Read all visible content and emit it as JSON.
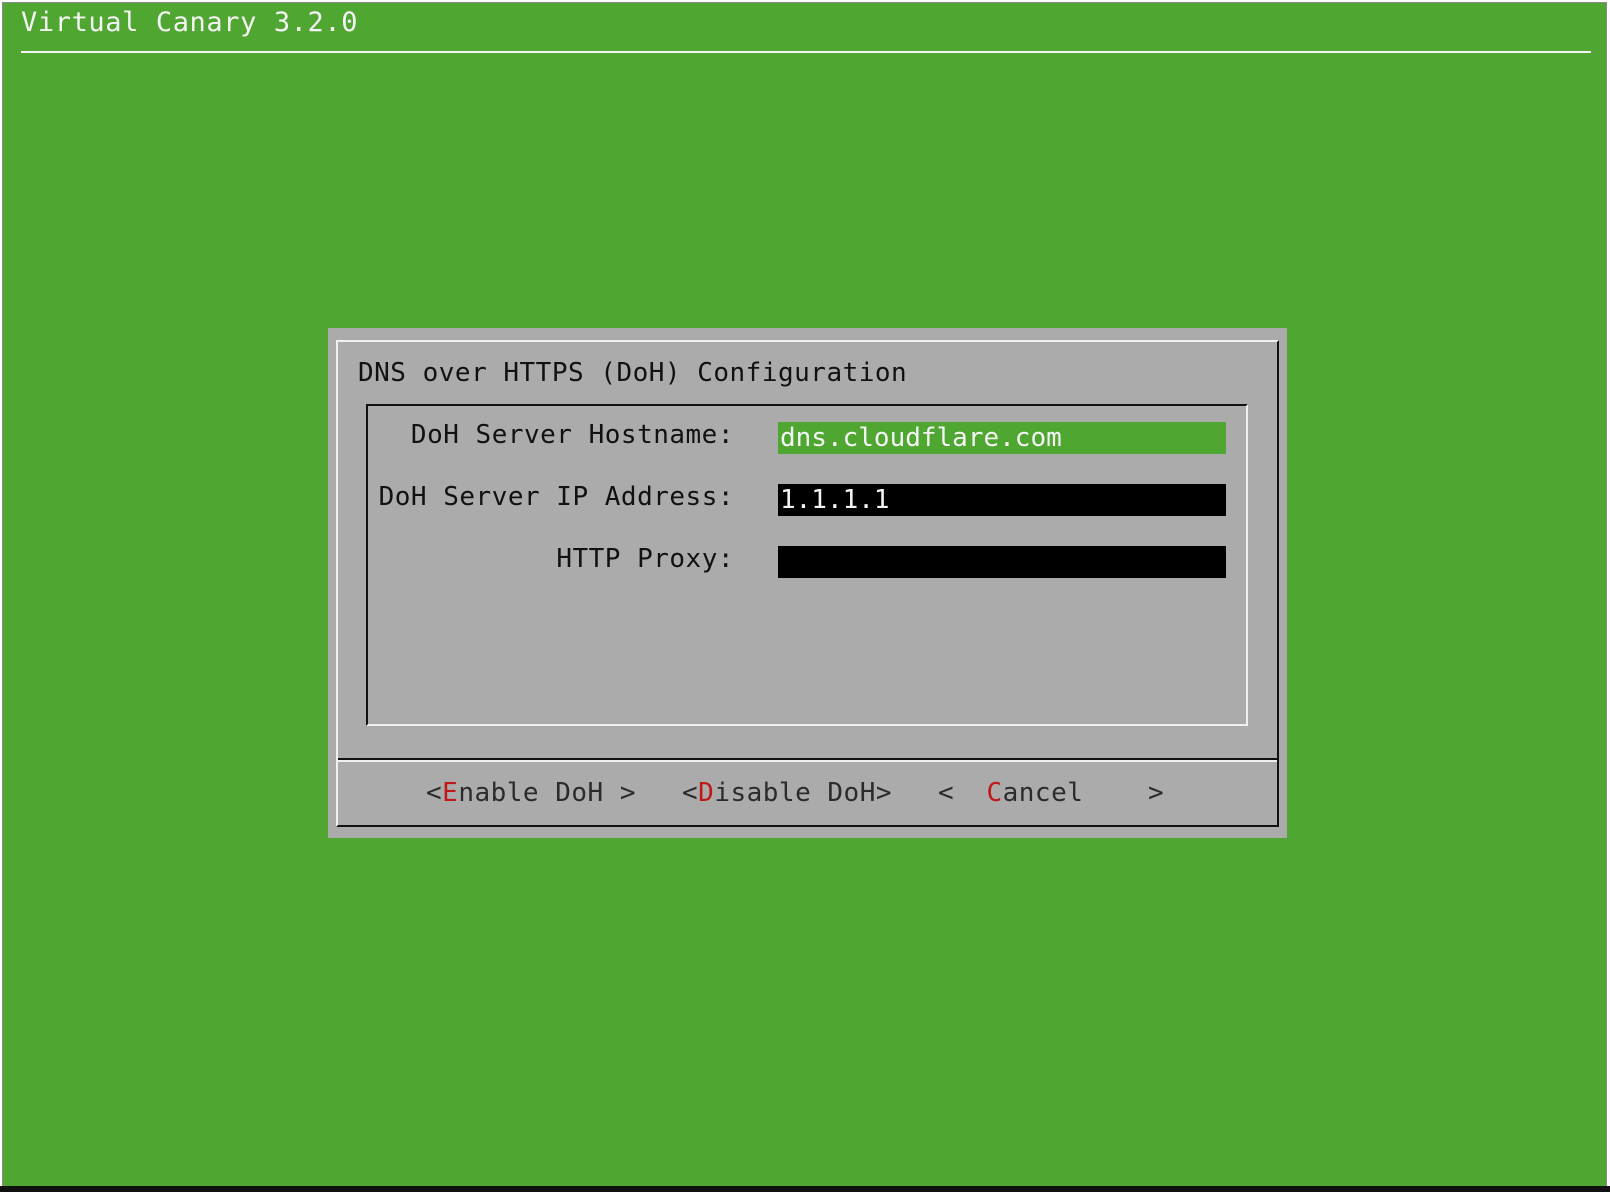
{
  "app": {
    "title": "Virtual Canary 3.2.0"
  },
  "dialog": {
    "title": "DNS over HTTPS (DoH) Configuration",
    "fields": [
      {
        "label": "DoH Server Hostname:",
        "value": "dns.cloudflare.com",
        "focused": true
      },
      {
        "label": "DoH Server IP Address:",
        "value": "1.1.1.1",
        "focused": false
      },
      {
        "label": "HTTP Proxy:",
        "value": "",
        "focused": false
      }
    ],
    "buttons": [
      {
        "open": "<",
        "hotkey": "E",
        "rest": "nable DoH",
        "close": " >"
      },
      {
        "open": "<",
        "hotkey": "D",
        "rest": "isable DoH",
        "close": ">"
      },
      {
        "open": "<  ",
        "hotkey": "C",
        "rest": "ancel",
        "close": "    >"
      }
    ]
  },
  "colors": {
    "background": "#4fa630",
    "dialog": "#ababab",
    "focused_input": "#4fa630",
    "input": "#000000",
    "hotkey": "#c01818"
  }
}
